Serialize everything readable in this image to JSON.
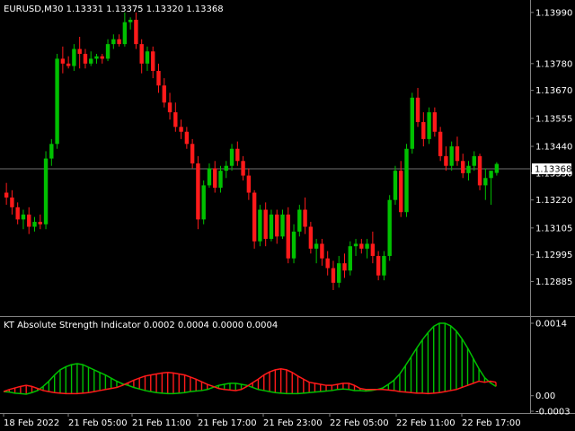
{
  "symbol_header": "EURUSD,M30  1.13331 1.13375 1.13320 1.13368",
  "indicator_header": "KT Absolute Strength Indicator 0.0002 0.0004 0.0000 0.0004",
  "current_price_label": "1.13368",
  "colors": {
    "background": "#000000",
    "bull": "#00c000",
    "bear": "#ff1a1a",
    "grid": "#808080",
    "text": "#ffffff",
    "price_line": "#707070"
  },
  "chart_data": [
    {
      "type": "candlestick",
      "name": "price",
      "ylim": [
        1.1278,
        1.1396
      ],
      "y_ticks": [
        "1.13990",
        "1.13780",
        "1.13670",
        "1.13555",
        "1.13440",
        "1.13330",
        "1.13220",
        "1.13105",
        "1.12995",
        "1.12885"
      ],
      "x_ticks": [
        "18 Feb 2022",
        "21 Feb 05:00",
        "21 Feb 11:00",
        "21 Feb 17:00",
        "21 Feb 23:00",
        "22 Feb 05:00",
        "22 Feb 11:00",
        "22 Feb 17:00"
      ],
      "current_price": 1.13368,
      "ohlc": [
        [
          1.1325,
          1.1329,
          1.132,
          1.1323
        ],
        [
          1.1323,
          1.1326,
          1.1316,
          1.1319
        ],
        [
          1.1319,
          1.1321,
          1.1312,
          1.1314
        ],
        [
          1.1314,
          1.1318,
          1.131,
          1.1316
        ],
        [
          1.1316,
          1.1319,
          1.1308,
          1.1311
        ],
        [
          1.1311,
          1.1315,
          1.1309,
          1.1313
        ],
        [
          1.1313,
          1.1316,
          1.131,
          1.1312
        ],
        [
          1.1312,
          1.1342,
          1.131,
          1.1339
        ],
        [
          1.1339,
          1.1347,
          1.1336,
          1.1345
        ],
        [
          1.1345,
          1.1382,
          1.1343,
          1.138
        ],
        [
          1.138,
          1.1385,
          1.1374,
          1.1378
        ],
        [
          1.1378,
          1.1381,
          1.1376,
          1.1377
        ],
        [
          1.1377,
          1.1386,
          1.1375,
          1.1384
        ],
        [
          1.1384,
          1.1389,
          1.1376,
          1.1382
        ],
        [
          1.1382,
          1.1384,
          1.1376,
          1.1378
        ],
        [
          1.1378,
          1.1383,
          1.1377,
          1.138
        ],
        [
          1.138,
          1.1382,
          1.1378,
          1.1381
        ],
        [
          1.1381,
          1.1382,
          1.1378,
          1.138
        ],
        [
          1.138,
          1.1388,
          1.1379,
          1.1386
        ],
        [
          1.1386,
          1.139,
          1.1384,
          1.1388
        ],
        [
          1.1388,
          1.139,
          1.1385,
          1.1386
        ],
        [
          1.1386,
          1.1399,
          1.1385,
          1.1395
        ],
        [
          1.1395,
          1.1397,
          1.1392,
          1.1396
        ],
        [
          1.1396,
          1.1399,
          1.1384,
          1.1386
        ],
        [
          1.1386,
          1.1388,
          1.1374,
          1.1378
        ],
        [
          1.1378,
          1.1385,
          1.1375,
          1.1383
        ],
        [
          1.1383,
          1.1385,
          1.1372,
          1.1375
        ],
        [
          1.1375,
          1.1378,
          1.1366,
          1.1369
        ],
        [
          1.1369,
          1.1372,
          1.136,
          1.1362
        ],
        [
          1.1362,
          1.1366,
          1.1355,
          1.1358
        ],
        [
          1.1358,
          1.1362,
          1.135,
          1.1352
        ],
        [
          1.1352,
          1.1355,
          1.1347,
          1.135
        ],
        [
          1.135,
          1.1352,
          1.1343,
          1.1345
        ],
        [
          1.1345,
          1.1347,
          1.1335,
          1.1337
        ],
        [
          1.1337,
          1.134,
          1.131,
          1.1314
        ],
        [
          1.1314,
          1.133,
          1.1312,
          1.1328
        ],
        [
          1.1328,
          1.1337,
          1.1327,
          1.1335
        ],
        [
          1.1335,
          1.1338,
          1.1325,
          1.1327
        ],
        [
          1.1327,
          1.1336,
          1.1325,
          1.1334
        ],
        [
          1.1334,
          1.1338,
          1.1331,
          1.1336
        ],
        [
          1.1336,
          1.1345,
          1.1334,
          1.1343
        ],
        [
          1.1343,
          1.1346,
          1.1336,
          1.1338
        ],
        [
          1.1338,
          1.134,
          1.133,
          1.1332
        ],
        [
          1.1332,
          1.1335,
          1.1322,
          1.1325
        ],
        [
          1.1325,
          1.1326,
          1.1302,
          1.1305
        ],
        [
          1.1305,
          1.132,
          1.1303,
          1.1318
        ],
        [
          1.1318,
          1.1321,
          1.1303,
          1.1306
        ],
        [
          1.1306,
          1.1318,
          1.1305,
          1.1316
        ],
        [
          1.1316,
          1.1318,
          1.1304,
          1.1307
        ],
        [
          1.1307,
          1.1318,
          1.1306,
          1.1316
        ],
        [
          1.1316,
          1.1319,
          1.1296,
          1.1298
        ],
        [
          1.1298,
          1.1312,
          1.1296,
          1.1309
        ],
        [
          1.1309,
          1.132,
          1.1307,
          1.1318
        ],
        [
          1.1318,
          1.1323,
          1.1308,
          1.1311
        ],
        [
          1.1311,
          1.1313,
          1.13,
          1.1302
        ],
        [
          1.1302,
          1.1306,
          1.1296,
          1.1304
        ],
        [
          1.1304,
          1.1306,
          1.1295,
          1.1298
        ],
        [
          1.1298,
          1.1301,
          1.1291,
          1.1294
        ],
        [
          1.1294,
          1.1297,
          1.1285,
          1.1288
        ],
        [
          1.1288,
          1.1299,
          1.1286,
          1.1296
        ],
        [
          1.1296,
          1.13,
          1.129,
          1.1293
        ],
        [
          1.1293,
          1.1305,
          1.1291,
          1.1303
        ],
        [
          1.1303,
          1.1306,
          1.1299,
          1.1304
        ],
        [
          1.1304,
          1.1306,
          1.13,
          1.1302
        ],
        [
          1.1302,
          1.1306,
          1.1298,
          1.1304
        ],
        [
          1.1304,
          1.1309,
          1.1296,
          1.1299
        ],
        [
          1.1299,
          1.1301,
          1.1289,
          1.1291
        ],
        [
          1.1291,
          1.1301,
          1.1289,
          1.1299
        ],
        [
          1.1299,
          1.1324,
          1.1297,
          1.1322
        ],
        [
          1.1322,
          1.1336,
          1.132,
          1.1334
        ],
        [
          1.1334,
          1.1338,
          1.1315,
          1.1317
        ],
        [
          1.1317,
          1.1345,
          1.1315,
          1.1343
        ],
        [
          1.1343,
          1.1366,
          1.1341,
          1.1364
        ],
        [
          1.1364,
          1.1368,
          1.1352,
          1.1354
        ],
        [
          1.1354,
          1.1358,
          1.1344,
          1.1347
        ],
        [
          1.1347,
          1.136,
          1.1345,
          1.1358
        ],
        [
          1.1358,
          1.136,
          1.1348,
          1.135
        ],
        [
          1.135,
          1.1352,
          1.1338,
          1.134
        ],
        [
          1.134,
          1.1344,
          1.1334,
          1.1336
        ],
        [
          1.1336,
          1.1346,
          1.1334,
          1.1344
        ],
        [
          1.1344,
          1.1348,
          1.1336,
          1.1338
        ],
        [
          1.1338,
          1.1341,
          1.1331,
          1.1333
        ],
        [
          1.1333,
          1.1338,
          1.133,
          1.1336
        ],
        [
          1.1336,
          1.1342,
          1.1334,
          1.134
        ],
        [
          1.134,
          1.1341,
          1.1326,
          1.1328
        ],
        [
          1.1328,
          1.1335,
          1.1322,
          1.1331
        ],
        [
          1.1331,
          1.1333,
          1.132,
          1.1334
        ],
        [
          1.13331,
          1.13375,
          1.1332,
          1.13368
        ]
      ]
    },
    {
      "type": "histogram",
      "name": "KT Absolute Strength Indicator",
      "ylim": [
        -0.0003,
        0.0014
      ],
      "y_ticks": [
        "0.0014",
        "0.00",
        "-0.0003"
      ],
      "bull": [
        8e-05,
        7e-05,
        5e-05,
        4e-05,
        3e-05,
        6e-05,
        0.0001,
        0.00018,
        0.00028,
        0.0004,
        0.0005,
        0.00056,
        0.0006,
        0.00062,
        0.0006,
        0.00055,
        0.0005,
        0.00045,
        0.0004,
        0.00034,
        0.00028,
        0.00023,
        0.0002,
        0.00016,
        0.00013,
        0.0001,
        8e-05,
        6e-05,
        5e-05,
        4e-05,
        4e-05,
        5e-05,
        6e-05,
        8e-05,
        9e-05,
        0.0001,
        0.00012,
        0.00016,
        0.0002,
        0.00022,
        0.00024,
        0.00024,
        0.00022,
        0.0002,
        0.00016,
        0.00012,
        0.0001,
        8e-05,
        6e-05,
        5e-05,
        4e-05,
        4e-05,
        4e-05,
        5e-05,
        6e-05,
        7e-05,
        8e-05,
        9e-05,
        0.0001,
        0.00012,
        0.00013,
        0.00012,
        0.0001,
        0.0001,
        9e-05,
        0.0001,
        0.00012,
        0.00015,
        0.00022,
        0.0003,
        0.00042,
        0.00058,
        0.00075,
        0.00092,
        0.00108,
        0.00122,
        0.00134,
        0.0014,
        0.0014,
        0.00135,
        0.00125,
        0.0011,
        0.00092,
        0.00072,
        0.00052,
        0.00035,
        0.00025,
        0.00018
      ],
      "bear": [
        8e-05,
        0.00012,
        0.00015,
        0.00018,
        0.0002,
        0.00018,
        0.00014,
        0.0001,
        8e-05,
        6e-05,
        5e-05,
        4e-05,
        4e-05,
        4e-05,
        5e-05,
        6e-05,
        8e-05,
        0.0001,
        0.00012,
        0.00014,
        0.00016,
        0.0002,
        0.00025,
        0.0003,
        0.00034,
        0.00038,
        0.0004,
        0.00042,
        0.00044,
        0.00045,
        0.00044,
        0.00042,
        0.0004,
        0.00036,
        0.00032,
        0.00027,
        0.00022,
        0.00018,
        0.00014,
        0.00012,
        0.00011,
        0.0001,
        0.00012,
        0.00018,
        0.00025,
        0.00032,
        0.0004,
        0.00046,
        0.0005,
        0.00052,
        0.0005,
        0.00045,
        0.00038,
        0.00032,
        0.00026,
        0.00024,
        0.00022,
        0.0002,
        0.0002,
        0.00022,
        0.00024,
        0.00024,
        0.0002,
        0.00014,
        0.00012,
        0.00012,
        0.00012,
        0.00012,
        0.00011,
        0.0001,
        8e-05,
        7e-05,
        6e-05,
        5e-05,
        5e-05,
        4e-05,
        5e-05,
        6e-05,
        8e-05,
        0.0001,
        0.00012,
        0.00016,
        0.0002,
        0.00024,
        0.00028,
        0.00026,
        0.00028,
        0.00026
      ]
    }
  ]
}
